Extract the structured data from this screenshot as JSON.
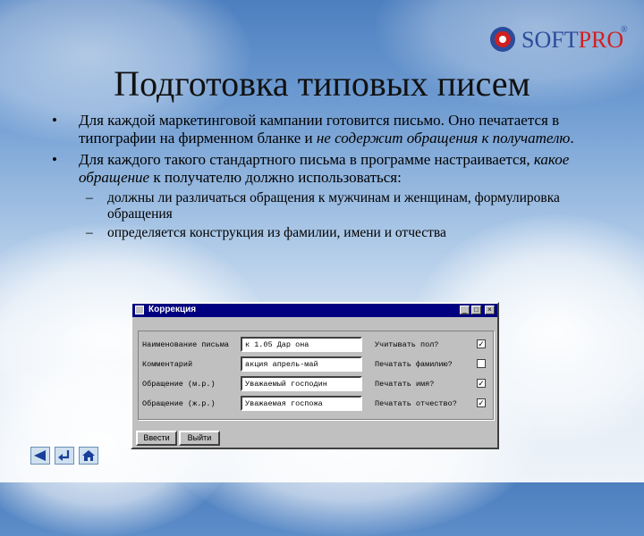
{
  "logo": {
    "soft": "SOFT",
    "pro": "PRO",
    "reg": "®"
  },
  "title": "Подготовка типовых писем",
  "bullet_char": "•",
  "dash_char": "–",
  "bullets": [
    {
      "pre": "Для каждой маркетинговой кампании готовится письмо. Оно печатается в типографии на фирменном бланке и ",
      "em": "не содержит обращения к получателю",
      "post": "."
    },
    {
      "pre": "Для каждого такого стандартного письма в программе настраивается, ",
      "em": "какое обращение",
      "post": " к получателю должно использоваться:"
    }
  ],
  "subs": [
    "должны ли различаться обращения к мужчинам и женщинам, формулировка обращения",
    "определяется конструкция из фамилии, имени и отчества"
  ],
  "dialog": {
    "title": "Коррекция",
    "win_buttons": [
      "_",
      "□",
      "×"
    ],
    "rows": [
      {
        "label": "Наименование письма",
        "value": "к 1.05 Дар она",
        "check_label": "Учитывать пол?",
        "checked": "✓"
      },
      {
        "label": "Комментарий",
        "value": "акция апрель-май",
        "check_label": "Печатать фамилию?",
        "checked": ""
      },
      {
        "label": "Обращение (м.р.)",
        "value": "Уважаемый господин",
        "check_label": "Печатать имя?",
        "checked": "✓"
      },
      {
        "label": "Обращение (ж.р.)",
        "value": "Уважаемая госпожа",
        "check_label": "Печатать отчество?",
        "checked": "✓"
      }
    ],
    "buttons": [
      "Ввести",
      "Выйти"
    ]
  },
  "nav": [
    "back-icon",
    "return-icon",
    "home-icon"
  ],
  "colors": {
    "nav_icon": "#1a3f9a",
    "soft": "#2b4c9b",
    "pro": "#d02020",
    "titlebar": "#000080"
  }
}
